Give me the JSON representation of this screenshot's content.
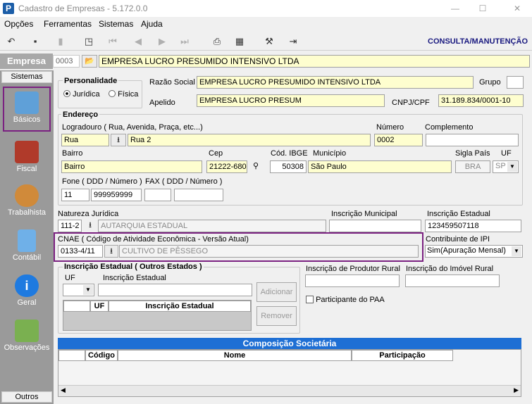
{
  "window": {
    "title": "Cadastro de Empresas - 5.172.0.0",
    "app_icon": "P"
  },
  "menu": [
    "Opções",
    "Ferramentas",
    "Sistemas",
    "Ajuda"
  ],
  "mode_label": "CONSULTA/MANUTENÇÃO",
  "empresa": {
    "label": "Empresa",
    "code": "0003",
    "name": "EMPRESA LUCRO PRESUMIDO INTENSIVO LTDA"
  },
  "sidebar": {
    "header": "Sistemas",
    "footer": "Outros",
    "items": [
      "Básicos",
      "Fiscal",
      "Trabalhista",
      "Contábil",
      "Geral",
      "Observações"
    ]
  },
  "personalidade": {
    "title": "Personalidade",
    "options": [
      "Jurídica",
      "Física"
    ]
  },
  "razao": {
    "label": "Razão Social",
    "value": "EMPRESA LUCRO PRESUMIDO INTENSIVO LTDA"
  },
  "grupo": {
    "label": "Grupo",
    "value": ""
  },
  "apelido": {
    "label": "Apelido",
    "value": "EMPRESA LUCRO PRESUM"
  },
  "cnpj": {
    "label": "CNPJ/CPF",
    "value": "31.189.834/0001-10"
  },
  "endereco": {
    "title": "Endereço",
    "logradouro_label": "Logradouro ( Rua, Avenida, Praça, etc...)",
    "logradouro_tipo": "Rua",
    "logradouro": "Rua 2",
    "numero_label": "Número",
    "numero": "0002",
    "complemento_label": "Complemento",
    "complemento": "",
    "bairro_label": "Bairro",
    "bairro": "Bairro",
    "cep_label": "Cep",
    "cep": "21222-680",
    "ibge_label": "Cód. IBGE",
    "ibge": "50308",
    "municipio_label": "Município",
    "municipio": "São Paulo",
    "pais_label": "Sigla País",
    "pais": "BRA",
    "uf_label": "UF",
    "uf": "SP",
    "fone_label": "Fone ( DDD / Número )",
    "fone_ddd": "11",
    "fone": "999959999",
    "fax_label": "FAX ( DDD / Número )",
    "fax_ddd": "",
    "fax": ""
  },
  "natureza": {
    "label": "Natureza Jurídica",
    "code": "111-2",
    "desc": "AUTARQUIA ESTADUAL"
  },
  "insc_municipal": {
    "label": "Inscrição Municipal",
    "value": ""
  },
  "insc_estadual": {
    "label": "Inscrição Estadual",
    "value": "123459507118"
  },
  "cnae": {
    "label": "CNAE ( Código de Atividade Econômica - Versão Atual)",
    "code": "0133-4/11",
    "desc": "CULTIVO DE PÊSSEGO"
  },
  "contribuinte": {
    "label": "Contribuinte de IPI",
    "value": "Sim(Apuração Mensal)"
  },
  "ie_outros": {
    "title": "Inscrição Estadual ( Outros Estados )",
    "uf_label": "UF",
    "ie_label": "Inscrição Estadual",
    "btn_add": "Adicionar",
    "btn_remove": "Remover",
    "col_uf": "UF",
    "col_ie": "Inscrição Estadual"
  },
  "produtor_rural": {
    "label": "Inscrição de Produtor Rural",
    "value": ""
  },
  "imovel_rural": {
    "label": "Inscrição do Imóvel Rural",
    "value": ""
  },
  "paa": {
    "label": "Participante do PAA"
  },
  "composicao": {
    "title": "Composição Societária",
    "cols": [
      "Código",
      "Nome",
      "Participação"
    ]
  }
}
